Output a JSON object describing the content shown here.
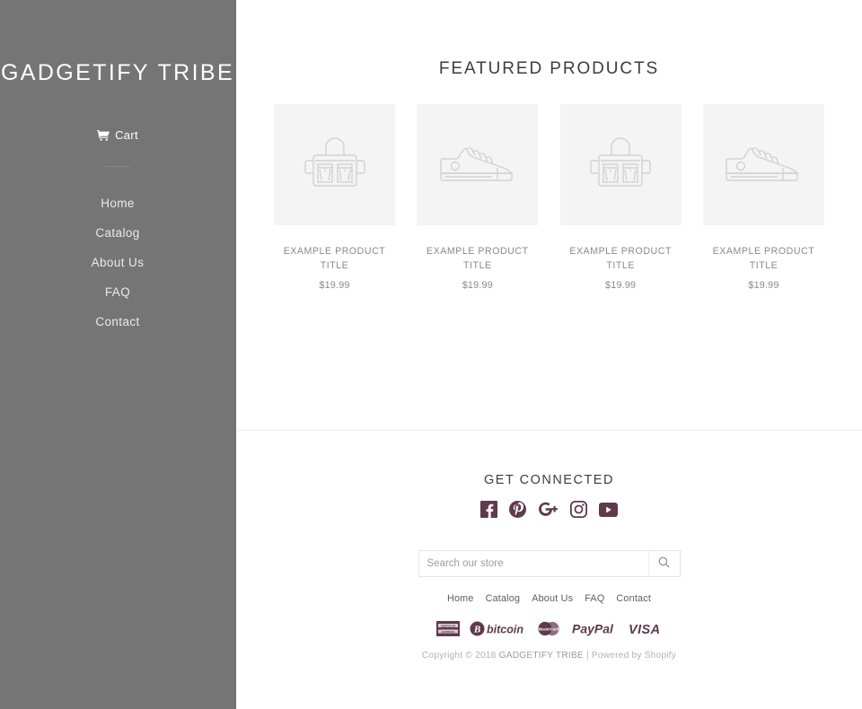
{
  "sidebar": {
    "brand": "GADGETIFY TRIBE",
    "cart": {
      "label": "Cart",
      "icon": "shopping-cart-icon"
    },
    "nav": [
      {
        "label": "Home"
      },
      {
        "label": "Catalog"
      },
      {
        "label": "About Us"
      },
      {
        "label": "FAQ"
      },
      {
        "label": "Contact"
      }
    ],
    "bg_color": "#757575"
  },
  "main": {
    "section_title": "FEATURED PRODUCTS",
    "products": [
      {
        "title": "EXAMPLE PRODUCT TITLE",
        "price": "$19.99",
        "icon": "bag-icon"
      },
      {
        "title": "EXAMPLE PRODUCT TITLE",
        "price": "$19.99",
        "icon": "shoe-icon"
      },
      {
        "title": "EXAMPLE PRODUCT TITLE",
        "price": "$19.99",
        "icon": "bag-icon"
      },
      {
        "title": "EXAMPLE PRODUCT TITLE",
        "price": "$19.99",
        "icon": "shoe-icon"
      }
    ]
  },
  "footer": {
    "title": "GET CONNECTED",
    "social": [
      {
        "name": "facebook-icon",
        "label": "Facebook"
      },
      {
        "name": "pinterest-icon",
        "label": "Pinterest"
      },
      {
        "name": "google-plus-icon",
        "label": "Google Plus"
      },
      {
        "name": "instagram-icon",
        "label": "Instagram"
      },
      {
        "name": "youtube-icon",
        "label": "YouTube"
      }
    ],
    "social_color": "#5e3a4c",
    "search": {
      "placeholder": "Search our store",
      "value": "",
      "button_icon": "search-icon"
    },
    "nav": [
      {
        "label": "Home"
      },
      {
        "label": "Catalog"
      },
      {
        "label": "About Us"
      },
      {
        "label": "FAQ"
      },
      {
        "label": "Contact"
      }
    ],
    "payments": [
      {
        "name": "american-express-icon",
        "label": "American Express"
      },
      {
        "name": "bitcoin-icon",
        "label": "bitcoin"
      },
      {
        "name": "mastercard-icon",
        "label": "MasterCard"
      },
      {
        "name": "paypal-icon",
        "label": "PayPal"
      },
      {
        "name": "visa-icon",
        "label": "VISA"
      }
    ],
    "copyright_prefix": "Copyright © 2018 ",
    "copyright_brand": "GADGETIFY TRIBE",
    "copyright_suffix": " | Powered by Shopify"
  }
}
